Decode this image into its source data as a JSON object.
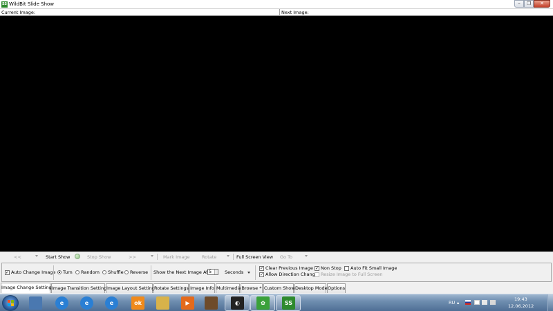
{
  "window": {
    "app_icon_text": "SS",
    "title": "WildBit Slide Show",
    "minimize_symbol": "–",
    "maximize_symbol": "❐",
    "close_symbol": "✕"
  },
  "image_header": {
    "current_label": "Current Image:",
    "next_label": "Next Image:"
  },
  "toolbar": {
    "prev": "<<",
    "start_show": "Start Show",
    "stop_show": "Stop Show",
    "next": ">>",
    "mark_image": "Mark Image",
    "rotate": "Rotate",
    "full_screen_view": "Full Screen View",
    "go_to": "Go To"
  },
  "settings": {
    "auto_change_image": {
      "label": "Auto Change Image",
      "checked": true
    },
    "order": {
      "turn": {
        "label": "Turn",
        "checked": true
      },
      "random": {
        "label": "Random",
        "checked": false
      },
      "shuffle": {
        "label": "Shuffle",
        "checked": false
      },
      "reverse": {
        "label": "Reverse",
        "checked": false
      }
    },
    "show_next_after_label": "Show the Next Image After",
    "interval_value": "5",
    "interval_unit": "Seconds",
    "clear_previous_image": {
      "label": "Clear Previous Image",
      "checked": true
    },
    "allow_direction_change": {
      "label": "Allow Direction Change",
      "checked": true
    },
    "non_stop": {
      "label": "Non Stop",
      "checked": true
    },
    "auto_fit_small_image": {
      "label": "Auto Fit Small Image",
      "checked": false
    },
    "resize_image_full_screen": {
      "label": "Resize Image to Full Screen",
      "checked": false
    }
  },
  "tabs": [
    {
      "label": "Image Change Settings",
      "active": true
    },
    {
      "label": "Image Transition Settings",
      "active": false
    },
    {
      "label": "Image Layout Settings",
      "active": false
    },
    {
      "label": "Rotate Settings",
      "active": false
    },
    {
      "label": "Image Info",
      "active": false
    },
    {
      "label": "Multimedia",
      "active": false
    },
    {
      "label": "Browse *",
      "active": false
    },
    {
      "label": "Custom Show",
      "active": false
    },
    {
      "label": "Desktop Mode",
      "active": false
    },
    {
      "label": "Options",
      "active": false
    }
  ],
  "taskbar": {
    "pinned": [
      {
        "name": "windows-explorer-icon",
        "color": "#4a78b0"
      },
      {
        "name": "internet-explorer-icon",
        "color": "#2a7fd4"
      },
      {
        "name": "internet-explorer-icon-2",
        "color": "#2a7fd4"
      },
      {
        "name": "internet-explorer-icon-3",
        "color": "#2a7fd4"
      },
      {
        "name": "odnoklassniki-icon",
        "color": "#f08a1c",
        "glyph": "ok"
      },
      {
        "name": "file-manager-icon",
        "color": "#d8b24a"
      },
      {
        "name": "media-player-icon",
        "color": "#e46a1c",
        "glyph": "▶"
      },
      {
        "name": "guitar-app-icon",
        "color": "#6e4b2a"
      }
    ],
    "running": [
      {
        "name": "media-app-icon",
        "color": "#222222",
        "glyph": "◐"
      },
      {
        "name": "icq-icon",
        "color": "#3aa13a",
        "glyph": "✿"
      },
      {
        "name": "slideshow-app-icon",
        "color": "#2e8a2e",
        "glyph": "SS"
      }
    ],
    "tray": {
      "language": "RU",
      "time": "19:43",
      "date": "12.06.2012",
      "flag_colors": [
        "#ffffff",
        "#1c3fa8",
        "#d52b1e"
      ]
    }
  }
}
